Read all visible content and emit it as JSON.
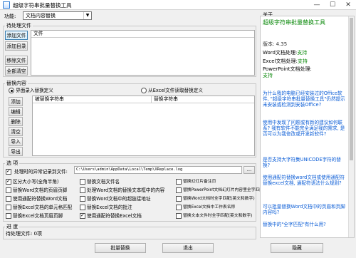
{
  "window": {
    "title": "超级字符串批量替换工具",
    "minimize": "—",
    "maximize": "☐",
    "close": "✕"
  },
  "function": {
    "label": "功能:",
    "selected": "文档内容替换"
  },
  "pending": {
    "group_label": "待处理文件",
    "buttons": [
      "添加文件",
      "添加目录",
      "移除文件",
      "全部清空"
    ],
    "column_header": "文件"
  },
  "replace": {
    "group_label": "替换内容",
    "radio_interface": "界面录入替换定义",
    "radio_excel": "从Excel文件读取替换定义",
    "buttons": [
      "添加",
      "编辑",
      "删除",
      "清空",
      "导入",
      "导出"
    ],
    "col_find": "被替换字符串",
    "col_replace": "替换字符串"
  },
  "options": {
    "group_label": "选 项",
    "log_label": "处理时的异常记录到文件:",
    "log_path": "C:\\Users\\admin\\AppData\\Local\\Temp\\XReplace.log",
    "browse": "...",
    "col1": [
      "区分大小写(全角半角)",
      "替换Word文档的页眉页脚",
      "使用通配符替换Word文档",
      "替换Excel文档的单元格匹配",
      "替换Excel文档页眉页脚"
    ],
    "col2": [
      "替换文档文件名",
      "处理Word文档的替换文本框中的内容",
      "替换Word文档中的超链接地址",
      "替换Excel文档的批注",
      "使用通配符替换Excel文档"
    ],
    "col3": [
      "替换幻灯片备注页",
      "替换PowerPoint文档幻灯片内容里全字匹配",
      "替换Word文档时全字匹配(英文和数字)",
      "替换Excel文档中工作表名称",
      "替换文本文件时全字匹配(英文和数字)"
    ]
  },
  "progress": {
    "group_label": "进 度",
    "text": "待处理文件: 0项"
  },
  "bottom": {
    "batch_replace": "批量替换",
    "exit": "退出",
    "hide": "隐藏"
  },
  "about": {
    "group_label": "关于",
    "product_title": "超级字符串批量替换工具",
    "version": "版本: 4.35",
    "word_label": "Word文档处理:",
    "word_value": "支持",
    "excel_label": "Excel文档处理:",
    "excel_value": "支持",
    "ppt_label": "PowerPoint文档处理:",
    "ppt_value": "支持",
    "faq": [
      "为什么我的电脑已经安装过的Office软件, \"超级字符串批量替换工具\"仍然提示未安装或检测到安装Office?",
      "使用中发现了问题或有新的建议如何联系? 我有软件不能完全满足我的需求, 是否可以为我修改或开发新软件?",
      "是否支持大字符集UNICODE字符的替换?",
      "使用通配符替换word文档或使用通配符替换excel文档, 通配符语法什么规则?",
      "可以批量替换Word文档中的页眉和页脚内容吗?",
      "替换中的\"全字匹配\"有什么用?"
    ]
  }
}
